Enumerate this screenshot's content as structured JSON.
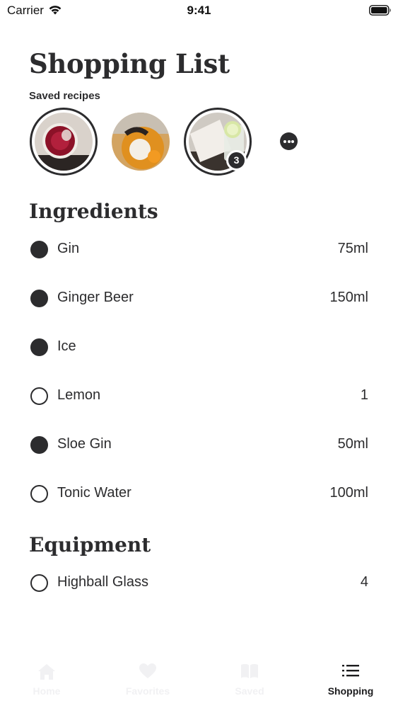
{
  "status_bar": {
    "carrier": "Carrier",
    "time": "9:41",
    "icons": [
      "wifi-icon",
      "battery-icon"
    ]
  },
  "header": {
    "title": "Shopping List",
    "saved_recipes_label": "Saved recipes"
  },
  "saved_recipes": [
    {
      "name": "recipe-thumbnail-red-drink",
      "selected": true
    },
    {
      "name": "recipe-thumbnail-orange-drink",
      "selected": false
    },
    {
      "name": "recipe-thumbnail-tonic-drink",
      "selected": true,
      "badge": "3"
    }
  ],
  "more_button_icon": "ellipsis-icon",
  "ingredients": {
    "title": "Ingredients",
    "items": [
      {
        "name": "Gin",
        "qty": "75ml",
        "checked": true
      },
      {
        "name": "Ginger Beer",
        "qty": "150ml",
        "checked": true
      },
      {
        "name": "Ice",
        "qty": "",
        "checked": true
      },
      {
        "name": "Lemon",
        "qty": "1",
        "checked": false
      },
      {
        "name": "Sloe Gin",
        "qty": "50ml",
        "checked": true
      },
      {
        "name": "Tonic Water",
        "qty": "100ml",
        "checked": false
      }
    ]
  },
  "equipment": {
    "title": "Equipment",
    "items": [
      {
        "name": "Highball Glass",
        "qty": "4",
        "checked": false
      }
    ]
  },
  "tab_bar": {
    "tabs": [
      {
        "label": "Home",
        "icon": "home-icon",
        "active": false
      },
      {
        "label": "Favorites",
        "icon": "heart-icon",
        "active": false
      },
      {
        "label": "Saved",
        "icon": "book-icon",
        "active": false
      },
      {
        "label": "Shopping",
        "icon": "list-icon",
        "active": true
      }
    ]
  },
  "colors": {
    "primary": "#2c2c2e",
    "inactive_tab": "#f1f1f3",
    "background": "#ffffff"
  }
}
